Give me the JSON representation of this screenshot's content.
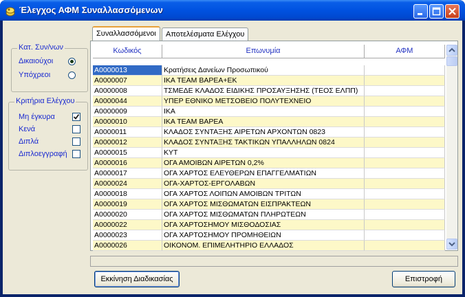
{
  "window": {
    "title": "Έλεγχος ΑΦΜ Συναλλασσόμενων"
  },
  "groups": {
    "category": {
      "legend": "Κατ. Συν/νων",
      "options": [
        {
          "label": "Δικαιούχοι",
          "selected": true
        },
        {
          "label": "Υπόχρεοι",
          "selected": false
        }
      ]
    },
    "criteria": {
      "legend": "Κριτήρια Ελέγχου",
      "options": [
        {
          "label": "Μη έγκυρα",
          "checked": true
        },
        {
          "label": "Κενά",
          "checked": false
        },
        {
          "label": "Διπλά",
          "checked": false
        },
        {
          "label": "Διπλοεγγραφή",
          "checked": false
        }
      ]
    }
  },
  "tabs": [
    {
      "label": "Συναλλασσόμενοι",
      "active": true
    },
    {
      "label": "Αποτελέσματα Ελέγχου",
      "active": false
    }
  ],
  "table": {
    "columns": [
      "Κωδικός",
      "Επωνυμία",
      "ΑΦΜ"
    ],
    "row_colors": {
      "white": "#ffffff",
      "yellow": "#fdf8c8",
      "selected": "#316ac5"
    },
    "rows": [
      {
        "code": "A0000013",
        "name": "Κρατήσεις Δανείων Προσωπικού",
        "afm": ""
      },
      {
        "code": "A0000007",
        "name": "ΙΚΑ TEAM ΒΑΡΕΑ+ΕΚ",
        "afm": ""
      },
      {
        "code": "A0000008",
        "name": "ΤΣΜΕΔΕ ΚΛΑΔΟΣ ΕΙΔΙΚΗΣ ΠΡΟΣΑΥΞΗΣΗΣ (ΤΕΟΣ ΕΛΠΠ)",
        "afm": ""
      },
      {
        "code": "A0000044",
        "name": "ΥΠΕΡ ΕΘΝΙΚΟ ΜΕΤΣΟΒΕΙΟ ΠΟΛΥΤΕΧΝΕΙΟ",
        "afm": ""
      },
      {
        "code": "A0000009",
        "name": "ΙΚΑ",
        "afm": ""
      },
      {
        "code": "A0000010",
        "name": "ΙΚΑ TEAM ΒΑΡΕΑ",
        "afm": ""
      },
      {
        "code": "A0000011",
        "name": "ΚΛΑΔΟΣ ΣΥΝΤΑΞΗΣ ΑΙΡΕΤΩΝ ΑΡΧΟΝΤΩΝ 0823",
        "afm": ""
      },
      {
        "code": "A0000012",
        "name": "ΚΛΑΔΟΣ ΣΥΝΤΑΞΗΣ ΤΑΚΤΙΚΩΝ ΥΠΑΛΛΗΛΩΝ 0824",
        "afm": ""
      },
      {
        "code": "A0000015",
        "name": "ΚΥΤ",
        "afm": ""
      },
      {
        "code": "A0000016",
        "name": "ΟΓΑ ΑΜΟΙΒΩΝ ΑΙΡΕΤΩΝ  0,2%",
        "afm": ""
      },
      {
        "code": "A0000017",
        "name": "ΟΓΑ ΧΑΡΤΟΣ ΕΛΕΥΘΕΡΩΝ ΕΠΑΓΓΕΛΜΑΤΙΩΝ",
        "afm": ""
      },
      {
        "code": "A0000024",
        "name": "ΟΓΑ-ΧΑΡΤΟΣ-ΕΡΓΟΛΑΒΩΝ",
        "afm": ""
      },
      {
        "code": "A0000018",
        "name": "ΟΓΑ ΧΑΡΤΟΣ ΛΟΙΠΩΝ ΑΜΟΙΒΩΝ ΤΡΙΤΩΝ",
        "afm": ""
      },
      {
        "code": "A0000019",
        "name": "ΟΓΑ ΧΑΡΤΟΣ ΜΙΣΘΩΜΑΤΩΝ ΕΙΣΠΡΑΚΤΕΩΝ",
        "afm": ""
      },
      {
        "code": "A0000020",
        "name": "ΟΓΑ ΧΑΡΤΟΣ ΜΙΣΘΩΜΑΤΩΝ ΠΛΗΡΩΤΕΩΝ",
        "afm": ""
      },
      {
        "code": "A0000022",
        "name": "ΟΓΑ ΧΑΡΤΟΣΗΜΟΥ ΜΙΣΘΟΔΟΣΙΑΣ",
        "afm": ""
      },
      {
        "code": "A0000023",
        "name": "ΟΓΑ ΧΑΡΤΟΣΗΜΟΥ ΠΡΟΜΗΘΕΙΩΝ",
        "afm": ""
      },
      {
        "code": "A0000026",
        "name": "ΟΙΚΟΝΟΜ. ΕΠΙΜΕΛΗΤΗΡΙΟ ΕΛΛΑΔΟΣ",
        "afm": ""
      }
    ]
  },
  "buttons": {
    "start": "Εκκίνηση Διαδικασίας",
    "back": "Επιστροφή"
  },
  "icons": [
    "app-icon",
    "minimize-icon",
    "maximize-icon",
    "close-icon",
    "scroll-up-icon",
    "scroll-down-icon"
  ]
}
